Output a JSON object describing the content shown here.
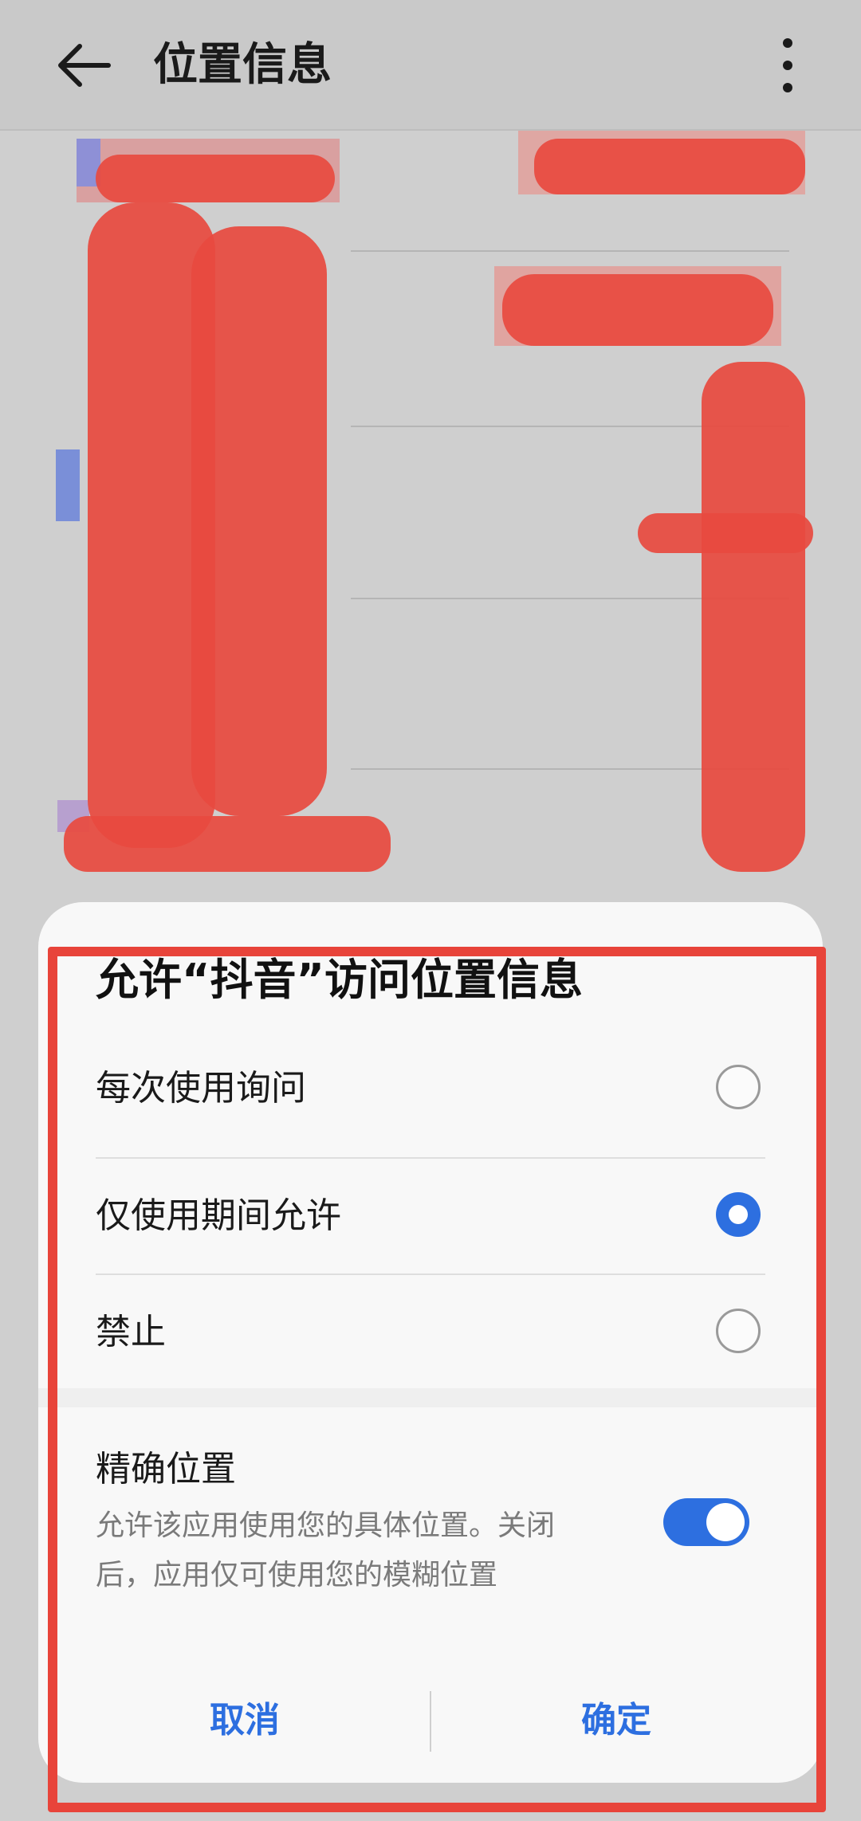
{
  "appbar": {
    "title": "位置信息",
    "back_icon": "arrow-left-icon",
    "more_icon": "more-vertical-icon"
  },
  "dialog": {
    "title": "允许“抖音”访问位置信息",
    "options": [
      {
        "label": "每次使用询问",
        "selected": false
      },
      {
        "label": "仅使用期间允许",
        "selected": true
      },
      {
        "label": "禁止",
        "selected": false
      }
    ],
    "precise": {
      "title": "精确位置",
      "description": "允许该应用使用您的具体位置。关闭后，应用仅可使用您的模糊位置",
      "enabled": true
    },
    "cancel_label": "取消",
    "confirm_label": "确定"
  },
  "colors": {
    "accent": "#2d6fe0",
    "annotation": "#e8443a"
  }
}
